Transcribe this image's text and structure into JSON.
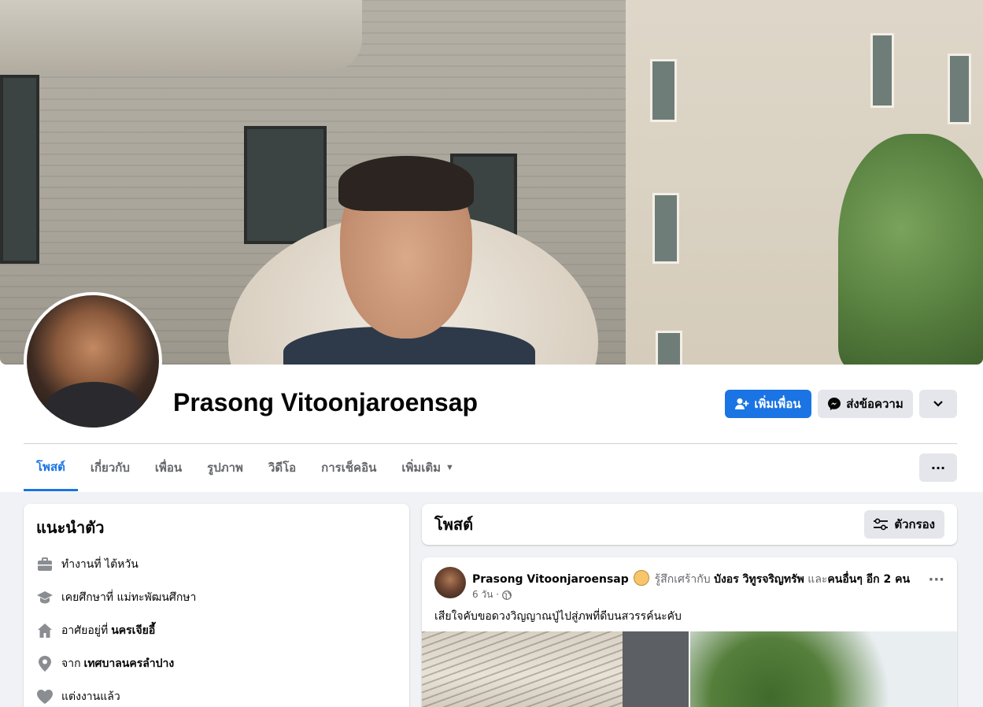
{
  "profile": {
    "name": "Prasong Vitoonjaroensap"
  },
  "actions": {
    "add_friend": "เพิ่มเพื่อน",
    "message": "ส่งข้อความ"
  },
  "tabs": [
    {
      "label": "โพสต์",
      "active": true
    },
    {
      "label": "เกี่ยวกับ",
      "active": false
    },
    {
      "label": "เพื่อน",
      "active": false
    },
    {
      "label": "รูปภาพ",
      "active": false
    },
    {
      "label": "วิดีโอ",
      "active": false
    },
    {
      "label": "การเช็คอิน",
      "active": false
    },
    {
      "label": "เพิ่มเติม",
      "active": false
    }
  ],
  "intro": {
    "title": "แนะนำตัว",
    "items": [
      {
        "icon": "briefcase-icon",
        "text": "ทำงานที่ ไต้หวัน",
        "bold": ""
      },
      {
        "icon": "graduation-cap-icon",
        "text": "เคยศึกษาที่ แม่ทะพัฒนศึกษา",
        "bold": ""
      },
      {
        "icon": "home-icon",
        "text": "อาศัยอยู่ที่",
        "bold": "นครเจียอี้"
      },
      {
        "icon": "location-pin-icon",
        "text": "จาก",
        "bold": "เทศบาลนครลำปาง"
      },
      {
        "icon": "heart-icon",
        "text": "แต่งงานแล้ว",
        "bold": ""
      }
    ]
  },
  "posts_header": {
    "title": "โพสต์",
    "filter_label": "ตัวกรอง"
  },
  "post": {
    "author": "Prasong Vitoonjaroensap",
    "feeling": "รู้สึกเศร้ากับ",
    "tagged": "บังอร วิทูรจริญทรัพ",
    "and": "และ",
    "others": "คนอื่นๆ อีก 2 คน",
    "time": "6 วัน ·",
    "text": "เสียใจคับขอดวงวิญญาณปู่ไปสู่ภพที่ดีบนสวรรค์นะคับ"
  },
  "colors": {
    "accent": "#1b74e4",
    "secondary_button": "#e4e6eb",
    "page_bg": "#f0f2f5"
  }
}
